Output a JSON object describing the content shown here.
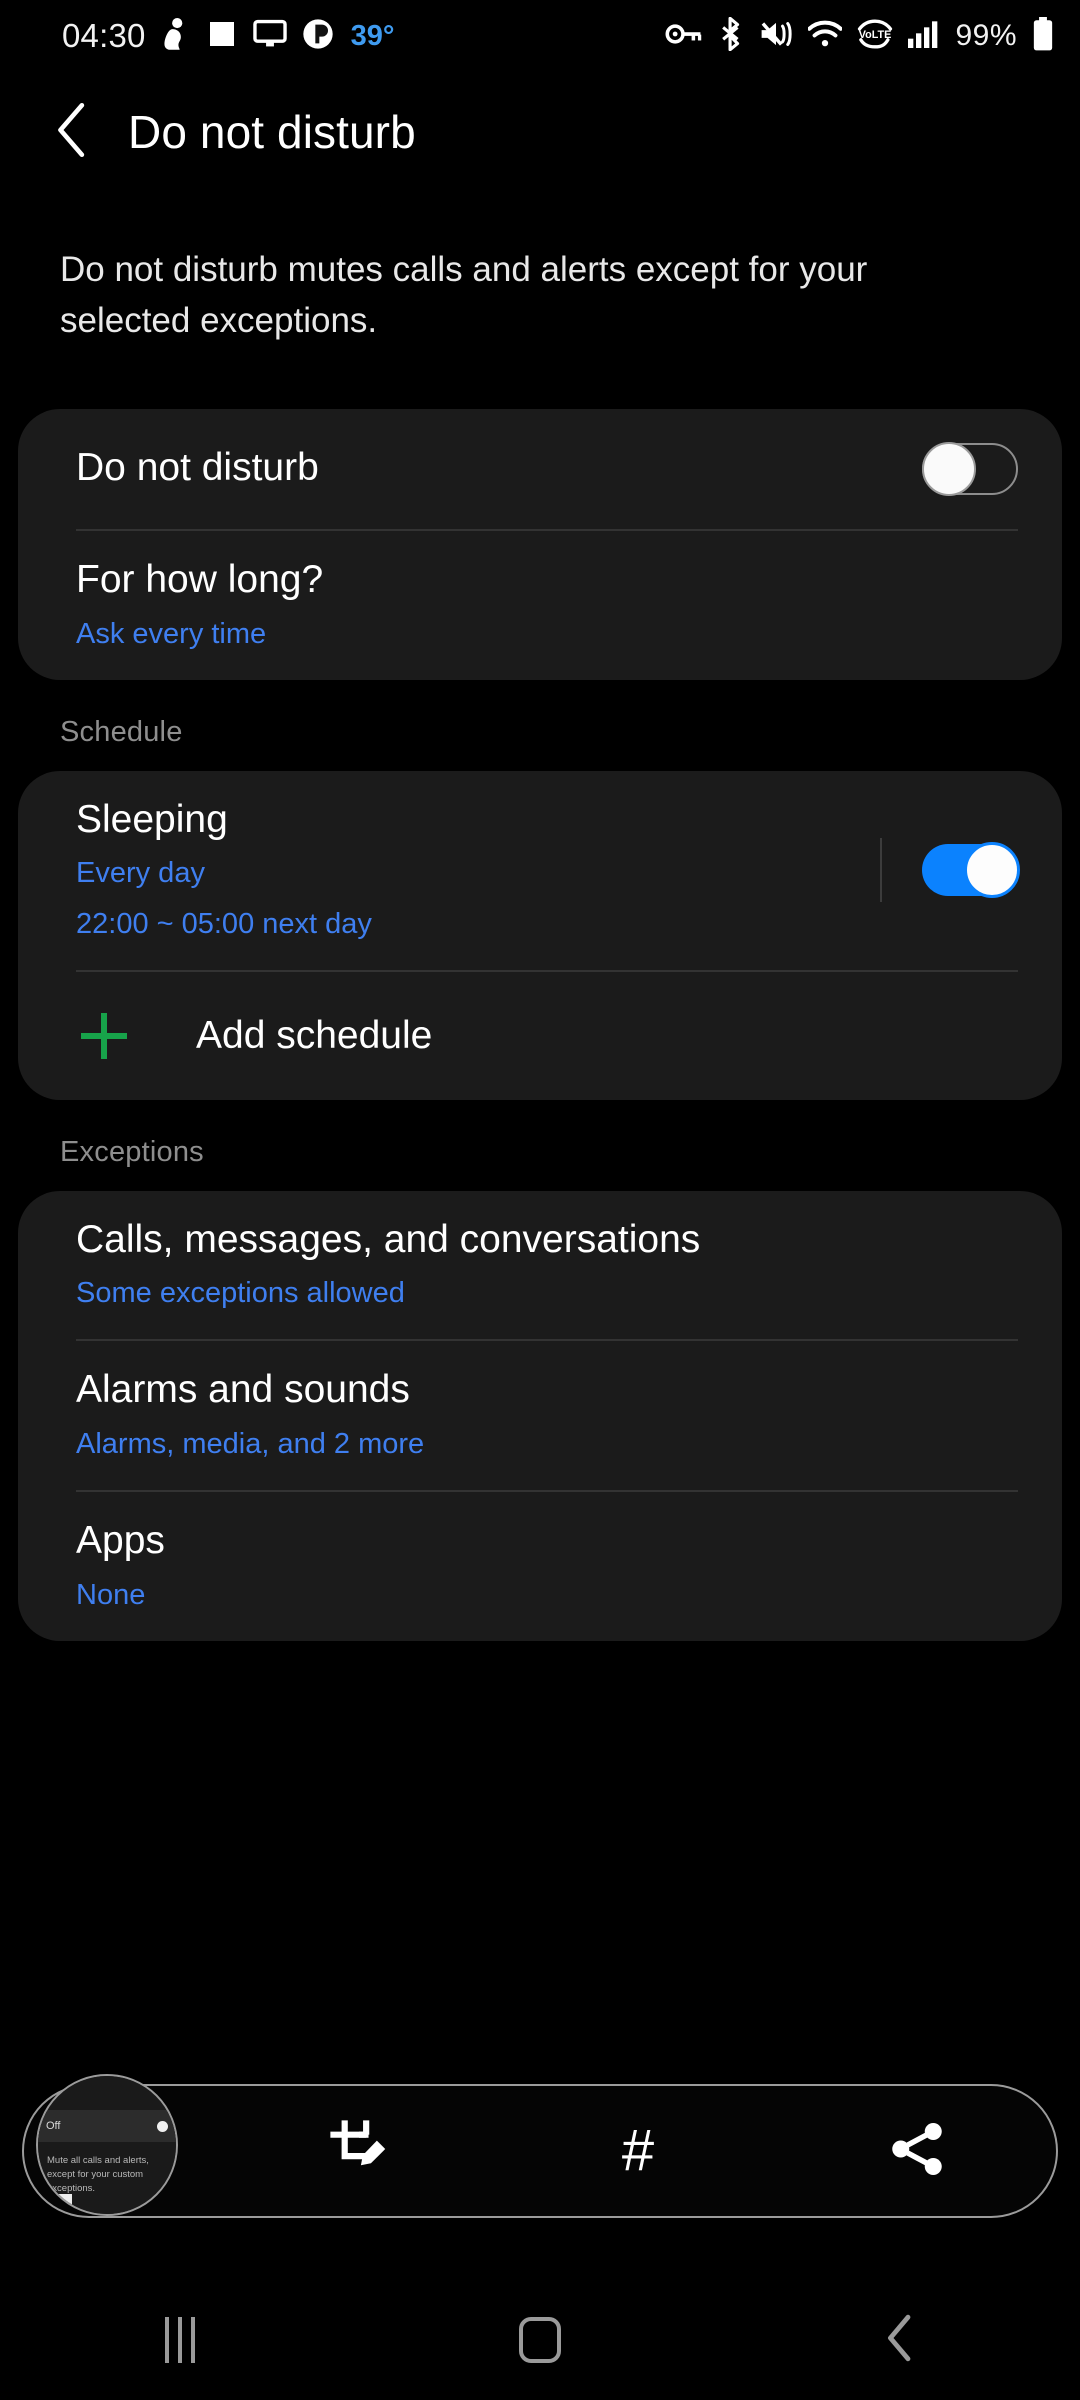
{
  "statusbar": {
    "time": "04:30",
    "temperature": "39°",
    "battery_percent": "99%",
    "left_icons": [
      "person-icon",
      "gallery-image-icon",
      "monitor-icon",
      "media-play-icon"
    ],
    "right_icons": [
      "vpn-key-icon",
      "bluetooth-icon",
      "vibrate-mute-icon",
      "wifi-icon",
      "volte-icon",
      "signal-bars-icon",
      "battery-icon"
    ],
    "accent_color": "#3f9bf0"
  },
  "appbar": {
    "back_icon": "chevron-left-icon",
    "title": "Do not disturb"
  },
  "description": "Do not disturb mutes calls and alerts except for your selected exceptions.",
  "main_card": {
    "dnd": {
      "title": "Do not disturb",
      "toggle_state": "off"
    },
    "duration": {
      "title": "For how long?",
      "subtitle": "Ask every time"
    }
  },
  "schedule": {
    "section_title": "Schedule",
    "items": [
      {
        "title": "Sleeping",
        "subtitle_days": "Every day",
        "subtitle_time": "22:00 ~ 05:00 next day",
        "toggle_state": "on"
      }
    ],
    "add": {
      "label": "Add schedule",
      "icon": "plus-icon",
      "icon_color": "#17a34a"
    }
  },
  "exceptions": {
    "section_title": "Exceptions",
    "items": [
      {
        "title": "Calls, messages, and conversations",
        "subtitle": "Some exceptions allowed"
      },
      {
        "title": "Alarms and sounds",
        "subtitle": "Alarms, media, and 2 more"
      },
      {
        "title": "Apps",
        "subtitle": "None"
      }
    ]
  },
  "screenshot_toolbar": {
    "thumbnail": {
      "status_label": "Off",
      "body_text": "Mute all calls and alerts, except for your custom exceptions."
    },
    "buttons": [
      {
        "name": "crop-edit-icon",
        "label": "#"
      }
    ],
    "tag_label": "#",
    "icons": [
      "crop-edit-icon",
      "hashtag-tag-icon",
      "share-icon"
    ]
  },
  "navbar": {
    "recents_icon": "recents-icon",
    "home_icon": "home-icon",
    "back_icon": "back-chevron-icon",
    "color": "#9a9a9a"
  },
  "colors": {
    "background": "#000000",
    "card": "#1b1b1b",
    "divider": "#333333",
    "accent_blue": "#3f7ff0",
    "toggle_on": "#0b82fe",
    "section_header": "#8e8e8e"
  }
}
